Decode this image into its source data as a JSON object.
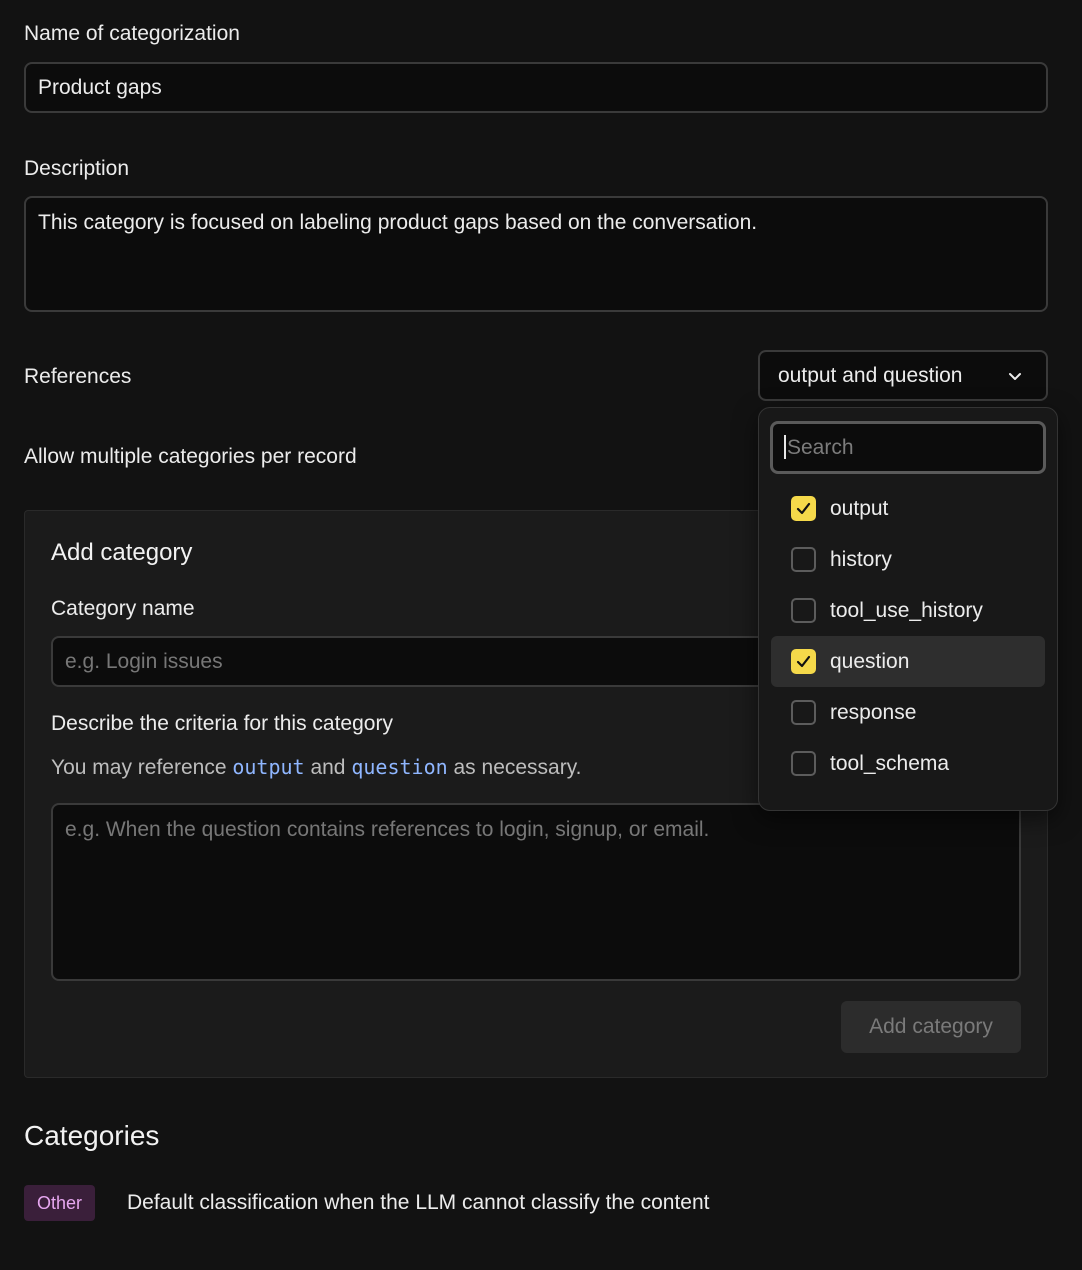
{
  "form": {
    "name_label": "Name of categorization",
    "name_value": "Product gaps",
    "description_label": "Description",
    "description_value": "This category is focused on labeling product gaps based on the conversation.",
    "references_label": "References",
    "references_value": "output and question",
    "multi_label": "Allow multiple categories per record"
  },
  "add_category": {
    "title": "Add category",
    "name_label": "Category name",
    "name_placeholder": "e.g. Login issues",
    "criteria_label": "Describe the criteria for this category",
    "hint_prefix": "You may reference",
    "hint_ref1": "output",
    "hint_and": "and",
    "hint_ref2": "question",
    "hint_suffix": "as necessary.",
    "criteria_placeholder": "e.g. When the question contains references to login, signup, or email.",
    "button_label": "Add category"
  },
  "categories": {
    "title": "Categories",
    "items": [
      {
        "badge": "Other",
        "description": "Default classification when the LLM cannot classify the content"
      }
    ]
  },
  "dropdown": {
    "search_placeholder": "Search",
    "options": [
      {
        "label": "output",
        "checked": true
      },
      {
        "label": "history",
        "checked": false
      },
      {
        "label": "tool_use_history",
        "checked": false
      },
      {
        "label": "question",
        "checked": true
      },
      {
        "label": "response",
        "checked": false
      },
      {
        "label": "tool_schema",
        "checked": false
      }
    ]
  },
  "colors": {
    "background": "#121212",
    "checkbox_checked": "#f5d94a",
    "code_reference": "#8fb6ff",
    "badge_bg": "#3a1f3a",
    "badge_text": "#e7a7f0"
  }
}
